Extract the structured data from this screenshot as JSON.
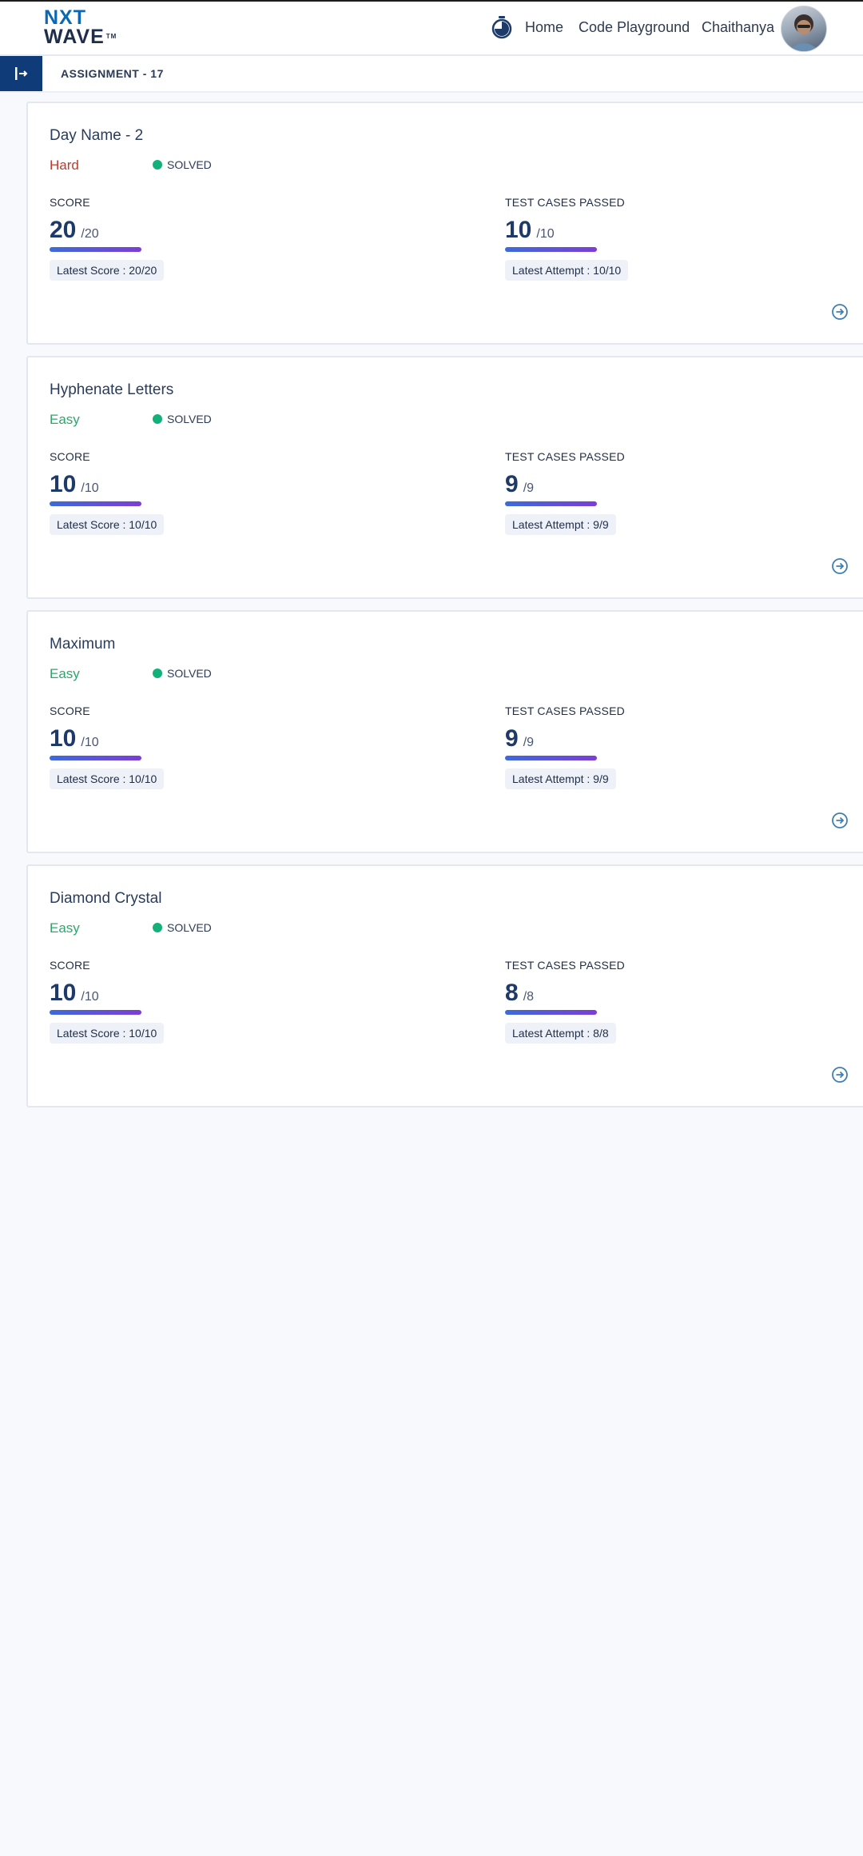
{
  "navbar": {
    "logo_line1": "NXT",
    "logo_line2": "WAVE",
    "logo_tm": "TM",
    "links": [
      "Home",
      "Code Playground",
      "Chaithanya"
    ]
  },
  "subbar": {
    "title": "ASSIGNMENT - 17"
  },
  "cards": [
    {
      "title": "Day Name - 2",
      "difficulty": "Hard",
      "status": "SOLVED",
      "score_label": "SCORE",
      "score": "20",
      "score_total": "/20",
      "latest_score": "Latest Score : 20/20",
      "tests_label": "TEST CASES PASSED",
      "tests": "10",
      "tests_total": "/10",
      "latest_attempt": "Latest Attempt : 10/10"
    },
    {
      "title": "Hyphenate Letters",
      "difficulty": "Easy",
      "status": "SOLVED",
      "score_label": "SCORE",
      "score": "10",
      "score_total": "/10",
      "latest_score": "Latest Score : 10/10",
      "tests_label": "TEST CASES PASSED",
      "tests": "9",
      "tests_total": "/9",
      "latest_attempt": "Latest Attempt : 9/9"
    },
    {
      "title": "Maximum",
      "difficulty": "Easy",
      "status": "SOLVED",
      "score_label": "SCORE",
      "score": "10",
      "score_total": "/10",
      "latest_score": "Latest Score : 10/10",
      "tests_label": "TEST CASES PASSED",
      "tests": "9",
      "tests_total": "/9",
      "latest_attempt": "Latest Attempt : 9/9"
    },
    {
      "title": "Diamond Crystal",
      "difficulty": "Easy",
      "status": "SOLVED",
      "score_label": "SCORE",
      "score": "10",
      "score_total": "/10",
      "latest_score": "Latest Score : 10/10",
      "tests_label": "TEST CASES PASSED",
      "tests": "8",
      "tests_total": "/8",
      "latest_attempt": "Latest Attempt : 8/8"
    }
  ],
  "colors": {
    "hard": "#c0392b",
    "easy": "#2fa56b",
    "solved_dot": "#13b07a",
    "toggle_bg": "#0f3b78",
    "progress_start": "#3d6ad8",
    "progress_end": "#7c3ed6"
  },
  "icons": [
    "timer-icon",
    "sidebar-toggle-icon",
    "arrow-right-circle-icon"
  ]
}
